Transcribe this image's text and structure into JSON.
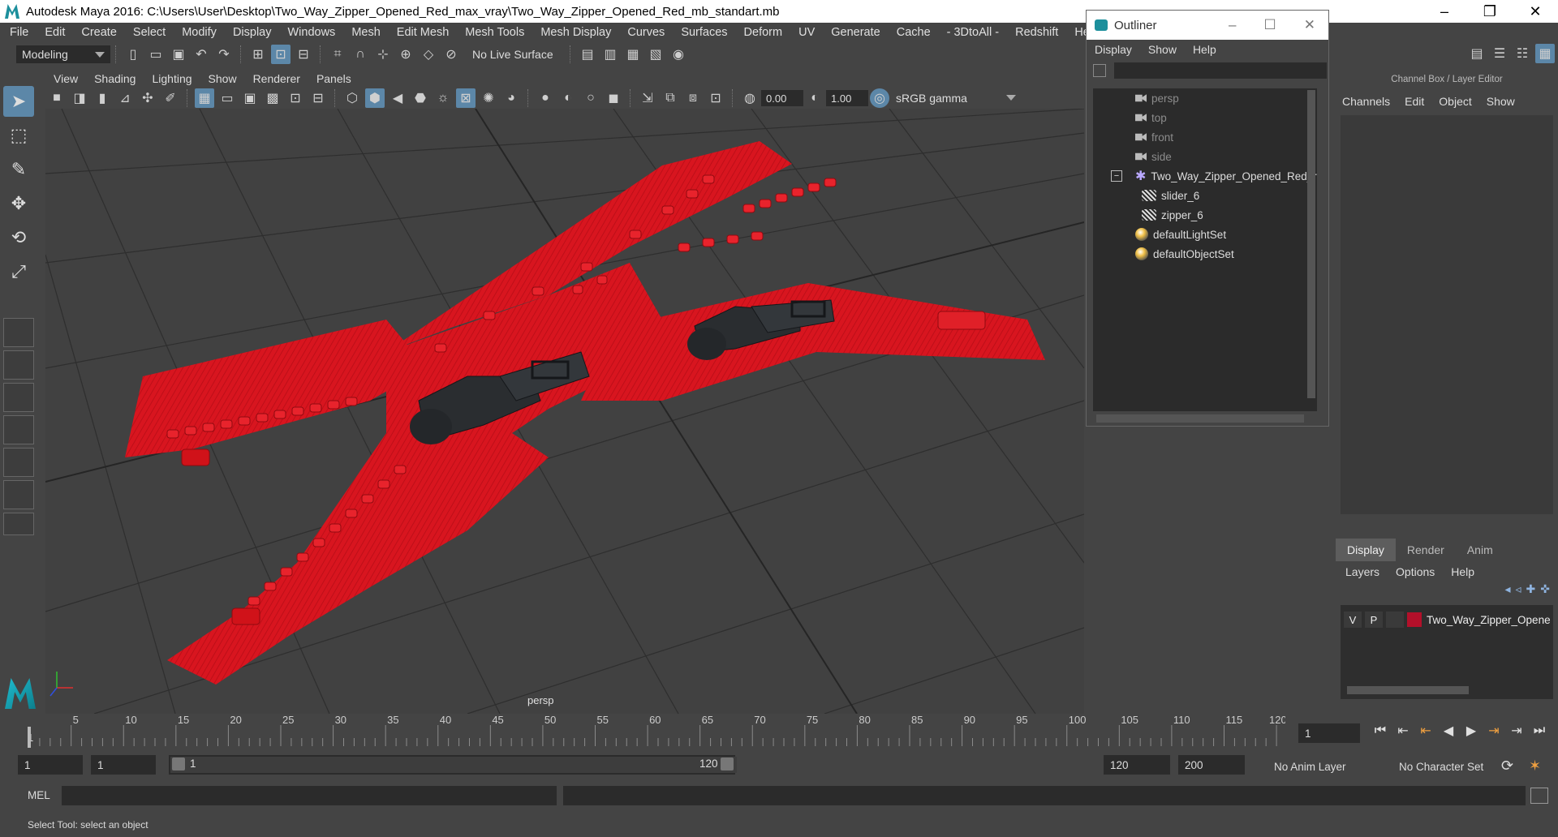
{
  "window": {
    "title": "Autodesk Maya 2016: C:\\Users\\User\\Desktop\\Two_Way_Zipper_Opened_Red_max_vray\\Two_Way_Zipper_Opened_Red_mb_standart.mb",
    "minimize": "–",
    "maximize": "❐",
    "close": "✕"
  },
  "menubar": [
    "File",
    "Edit",
    "Create",
    "Select",
    "Modify",
    "Display",
    "Windows",
    "Mesh",
    "Edit Mesh",
    "Mesh Tools",
    "Mesh Display",
    "Curves",
    "Surfaces",
    "Deform",
    "UV",
    "Generate",
    "Cache",
    "- 3DtoAll -",
    "Redshift",
    "Help"
  ],
  "statusline": {
    "mode": "Modeling",
    "live_surface": "No Live Surface"
  },
  "viewport": {
    "menu": [
      "View",
      "Shading",
      "Lighting",
      "Show",
      "Renderer",
      "Panels"
    ],
    "exposure": "0.00",
    "gamma": "1.00",
    "color_space": "sRGB gamma",
    "camera_label": "persp"
  },
  "outliner": {
    "title": "Outliner",
    "menu": [
      "Display",
      "Show",
      "Help"
    ],
    "items": [
      {
        "label": "persp"
      },
      {
        "label": "top"
      },
      {
        "label": "front"
      },
      {
        "label": "side"
      },
      {
        "label": "Two_Way_Zipper_Opened_Red_r"
      },
      {
        "label": "slider_6"
      },
      {
        "label": "zipper_6"
      },
      {
        "label": "defaultLightSet"
      },
      {
        "label": "defaultObjectSet"
      }
    ]
  },
  "channelbox": {
    "header": "Channel Box / Layer Editor",
    "menu": [
      "Channels",
      "Edit",
      "Object",
      "Show"
    ]
  },
  "layereditor": {
    "tabs": [
      "Display",
      "Render",
      "Anim"
    ],
    "menu": [
      "Layers",
      "Options",
      "Help"
    ],
    "layer": {
      "v": "V",
      "p": "P",
      "name": "Two_Way_Zipper_Opene",
      "color": "#b3102a"
    }
  },
  "timeslider": {
    "ticks": [
      "5",
      "10",
      "15",
      "20",
      "25",
      "30",
      "35",
      "40",
      "45",
      "50",
      "55",
      "60",
      "65",
      "70",
      "75",
      "80",
      "85",
      "90",
      "95",
      "100",
      "105",
      "110",
      "115",
      "120"
    ],
    "start_tick": "1",
    "current_frame": "1"
  },
  "range": {
    "start": "1",
    "playback_start": "1",
    "range_start": "1",
    "range_end": "120",
    "playback_end": "120",
    "end": "200",
    "anim_layer": "No Anim Layer",
    "character_set": "No Character Set"
  },
  "mel": {
    "label": "MEL"
  },
  "status": {
    "help": "Select Tool: select an object"
  },
  "colors": {
    "zipper": "#d8151f",
    "slider": "#2a2d30",
    "accent": "#5c87a8"
  }
}
